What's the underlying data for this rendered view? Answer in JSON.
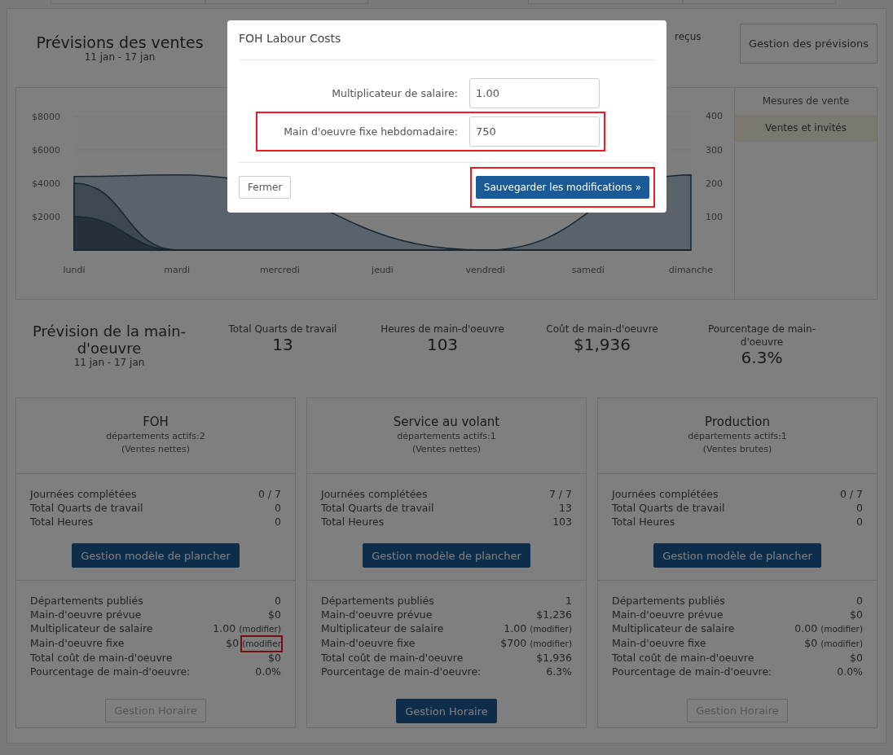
{
  "sales_header": {
    "title": "Prévisions des ventes",
    "dates": "11 jan - 17 jan",
    "partial_text": "reçus",
    "button": "Gestion des prévisions"
  },
  "sales_chart": {
    "chart_data": {
      "type": "area",
      "categories": [
        "lundi",
        "mardi",
        "mercredi",
        "jeudi",
        "vendredi",
        "samedi",
        "dimanche"
      ],
      "ylim": [
        -2976,
        9756
      ],
      "yticks": [
        {
          "value": 2000,
          "label": "$2000"
        },
        {
          "value": 4000,
          "label": "$4000"
        },
        {
          "value": 6000,
          "label": "$6000"
        },
        {
          "value": 8000,
          "label": "$8000"
        }
      ],
      "y2lim": [
        -146.3,
        485.4
      ],
      "y2ticks": [
        100,
        200,
        300,
        400
      ],
      "stacked": false,
      "series": [
        {
          "color": "#b5c6d3",
          "values": [
            4400,
            4500,
            null,
            null,
            0,
            null,
            4500
          ]
        },
        {
          "color": "#7b91a2",
          "values": [
            4000,
            0,
            0,
            0,
            0,
            0,
            0
          ]
        },
        {
          "color": "#4b6174",
          "values": [
            2000,
            0,
            0,
            0,
            0,
            0,
            0
          ]
        }
      ]
    }
  },
  "chart_menu": [
    {
      "label": "Mesures de vente",
      "selected": false
    },
    {
      "label": "Ventes et invités",
      "selected": true
    }
  ],
  "labour_header": {
    "title": "Prévision de la main-d'oeuvre",
    "dates": "11 jan - 17 jan",
    "stats": [
      {
        "label": "Total Quarts de travail",
        "value": "13"
      },
      {
        "label": "Heures de main-d'oeuvre",
        "value": "103"
      },
      {
        "label": "Coût de main-d'oeuvre",
        "value": "$1,936"
      },
      {
        "label": "Pourcentage de main-d'oeuvre",
        "value": "6.3%"
      }
    ]
  },
  "departments": [
    {
      "name": "FOH",
      "active": "départements actifs:2",
      "basis": "(Ventes nettes)",
      "stats": [
        {
          "label": "Journées complétées",
          "value": "0 / 7"
        },
        {
          "label": "Total Quarts de travail",
          "value": "0"
        },
        {
          "label": "Total Heures",
          "value": "0"
        }
      ],
      "floor_button": "Gestion modèle de plancher",
      "cost_stats": [
        {
          "label": "Départements publiés",
          "value": "0"
        },
        {
          "label": "Main-d'oeuvre prévue",
          "value": "$0"
        },
        {
          "label": "Multiplicateur de salaire",
          "value": "1.00",
          "link": "(modifier)",
          "highlighted": false
        },
        {
          "label": "Main-d'oeuvre fixe",
          "value": "$0",
          "link": "(modifier",
          "highlighted": true
        },
        {
          "label": "Total coût de main-d'oeuvre",
          "value": "$0"
        },
        {
          "label": "Pourcentage de main-d'oeuvre:",
          "value": "0.0%"
        }
      ],
      "schedule_button": {
        "label": "Gestion Horaire",
        "disabled": true
      }
    },
    {
      "name": "Service au volant",
      "active": "départements actifs:1",
      "basis": "(Ventes nettes)",
      "stats": [
        {
          "label": "Journées complétées",
          "value": "7 / 7"
        },
        {
          "label": "Total Quarts de travail",
          "value": "13"
        },
        {
          "label": "Total Heures",
          "value": "103"
        }
      ],
      "floor_button": "Gestion modèle de plancher",
      "cost_stats": [
        {
          "label": "Départements publiés",
          "value": "1"
        },
        {
          "label": "Main-d'oeuvre prévue",
          "value": "$1,236"
        },
        {
          "label": "Multiplicateur de salaire",
          "value": "1.00",
          "link": "(modifier)",
          "highlighted": false
        },
        {
          "label": "Main-d'oeuvre fixe",
          "value": "$700",
          "link": "(modifier)",
          "highlighted": false
        },
        {
          "label": "Total coût de main-d'oeuvre",
          "value": "$1,936"
        },
        {
          "label": "Pourcentage de main-d'oeuvre:",
          "value": "6.3%"
        }
      ],
      "schedule_button": {
        "label": "Gestion Horaire",
        "disabled": false
      }
    },
    {
      "name": "Production",
      "active": "départements actifs:1",
      "basis": "(Ventes brutes)",
      "stats": [
        {
          "label": "Journées complétées",
          "value": "0 / 7"
        },
        {
          "label": "Total Quarts de travail",
          "value": "0"
        },
        {
          "label": "Total Heures",
          "value": "0"
        }
      ],
      "floor_button": "Gestion modèle de plancher",
      "cost_stats": [
        {
          "label": "Départements publiés",
          "value": "0"
        },
        {
          "label": "Main-d'oeuvre prévue",
          "value": "$0"
        },
        {
          "label": "Multiplicateur de salaire",
          "value": "0.00",
          "link": "(modifier)",
          "highlighted": false
        },
        {
          "label": "Main-d'oeuvre fixe",
          "value": "$0",
          "link": "(modifier)",
          "highlighted": false
        },
        {
          "label": "Total coût de main-d'oeuvre",
          "value": "$0"
        },
        {
          "label": "Pourcentage de main-d'oeuvre:",
          "value": "0.0%"
        }
      ],
      "schedule_button": {
        "label": "Gestion Horaire",
        "disabled": true
      }
    }
  ],
  "modal": {
    "title": "FOH Labour Costs",
    "fields": [
      {
        "label": "Multiplicateur de salaire:",
        "value": "1.00",
        "highlighted": false
      },
      {
        "label": "Main d'oeuvre fixe hebdomadaire:",
        "value": "750",
        "highlighted": true
      }
    ],
    "close_button": "Fermer",
    "save_button": {
      "label": "Sauvegarder les modifications »",
      "highlighted": true
    }
  }
}
